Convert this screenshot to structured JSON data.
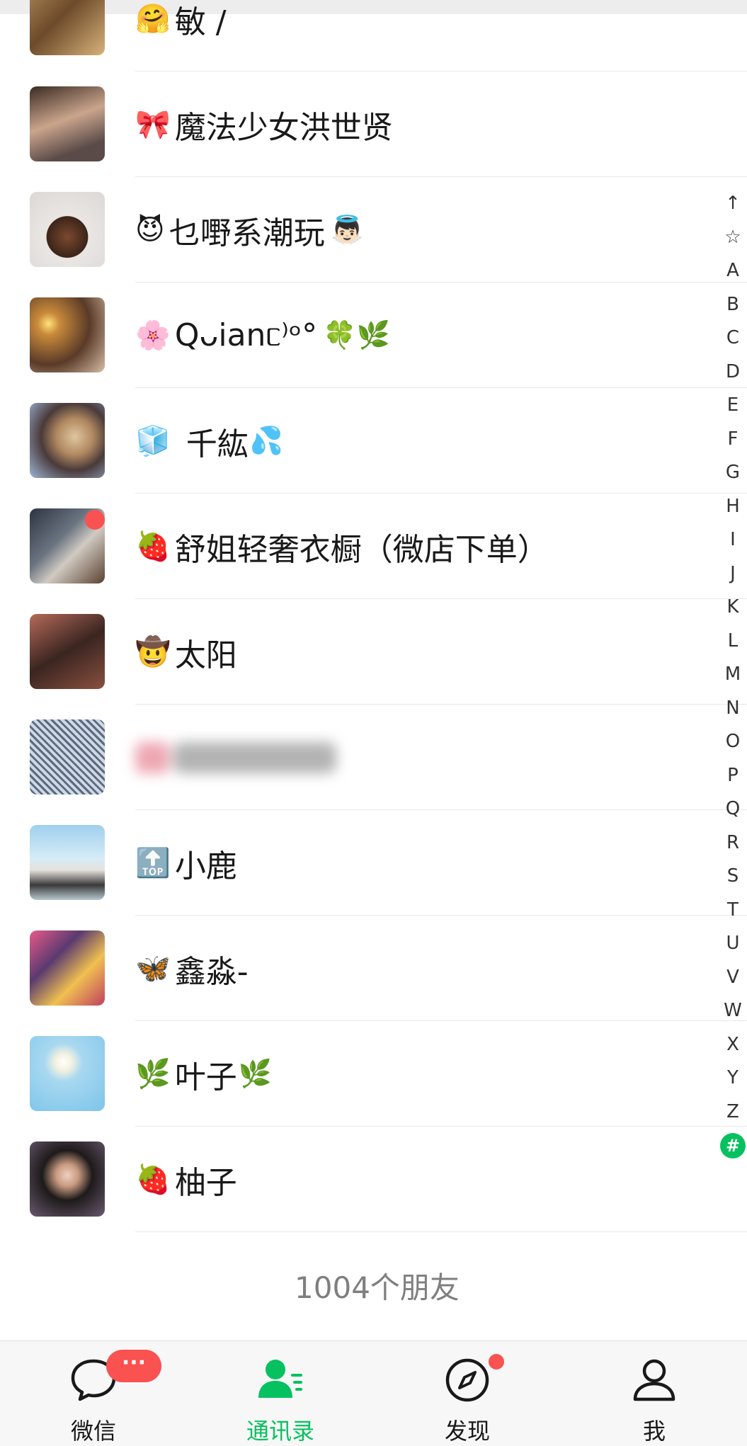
{
  "contacts": [
    {
      "name": "敏 /",
      "emoji_before": "🤗",
      "emoji_after": ""
    },
    {
      "name": "魔法少女洪世贤",
      "emoji_before": "🎀",
      "emoji_after": ""
    },
    {
      "name": "乜嘢系潮玩",
      "emoji_before": "😈",
      "emoji_after": "👼🏻"
    },
    {
      "name": "Qᴗianᥴ⁾ᵒ°",
      "emoji_before": "🌸",
      "emoji_after": "🍀🌿"
    },
    {
      "name": "千紘",
      "emoji_before": "🧊",
      "emoji_after": "💦"
    },
    {
      "name": "舒姐轻奢衣橱（微店下单）",
      "emoji_before": "🍓",
      "emoji_after": ""
    },
    {
      "name": "太阳",
      "emoji_before": "🤠",
      "emoji_after": ""
    },
    {
      "name": "",
      "emoji_before": "",
      "emoji_after": ""
    },
    {
      "name": "小鹿",
      "emoji_before": "🔝",
      "emoji_after": ""
    },
    {
      "name": "鑫淼-",
      "emoji_before": "🦋",
      "emoji_after": ""
    },
    {
      "name": "叶子",
      "emoji_before": "🌿",
      "emoji_after": "🌿"
    },
    {
      "name": "柚子",
      "emoji_before": "🍓",
      "emoji_after": ""
    }
  ],
  "index_letters": [
    "↑",
    "☆",
    "A",
    "B",
    "C",
    "D",
    "E",
    "F",
    "G",
    "H",
    "I",
    "J",
    "K",
    "L",
    "M",
    "N",
    "O",
    "P",
    "Q",
    "R",
    "S",
    "T",
    "U",
    "V",
    "W",
    "X",
    "Y",
    "Z",
    "#"
  ],
  "index_active": "#",
  "friend_count": "1004个朋友",
  "tabbar": {
    "chats_label": "微信",
    "contacts_label": "通讯录",
    "discover_label": "发现",
    "me_label": "我",
    "chats_badge": "···"
  },
  "colors": {
    "accent": "#07c160",
    "badge": "#fa5151",
    "text": "#191919",
    "muted": "#7f7f7f"
  }
}
